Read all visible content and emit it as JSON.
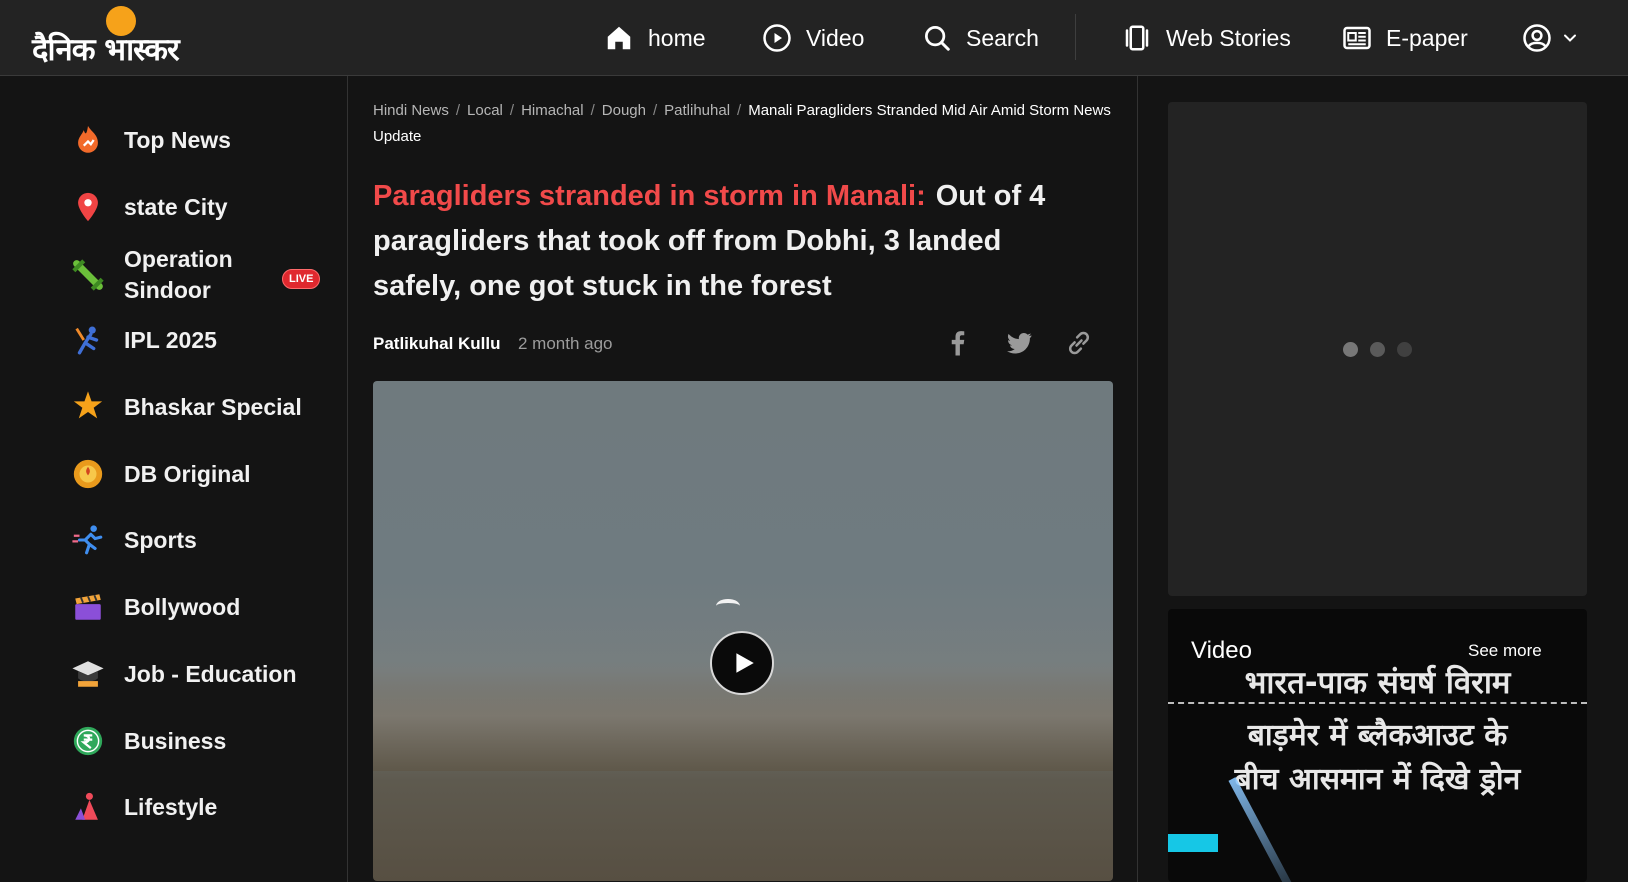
{
  "header": {
    "logo_text": "दैनिक भास्कर",
    "nav": [
      {
        "label": "home",
        "icon": "home-icon"
      },
      {
        "label": "Video",
        "icon": "play-circle-icon"
      },
      {
        "label": "Search",
        "icon": "search-icon"
      },
      {
        "label": "Web Stories",
        "icon": "web-stories-icon"
      },
      {
        "label": "E-paper",
        "icon": "newspaper-icon"
      }
    ],
    "account_icon": "user-circle-icon"
  },
  "sidebar": {
    "items": [
      {
        "label": "Top News",
        "icon": "flame-icon"
      },
      {
        "label": "state City",
        "icon": "location-pin-icon"
      },
      {
        "label": "Operation Sindoor",
        "icon": "missile-icon",
        "badge": "LIVE"
      },
      {
        "label": "IPL 2025",
        "icon": "cricket-icon"
      },
      {
        "label": "Bhaskar Special",
        "icon": "star-icon"
      },
      {
        "label": "DB Original",
        "icon": "db-original-icon"
      },
      {
        "label": "Sports",
        "icon": "runner-icon"
      },
      {
        "label": "Bollywood",
        "icon": "clapperboard-icon"
      },
      {
        "label": "Job - Education",
        "icon": "graduation-cap-icon"
      },
      {
        "label": "Business",
        "icon": "rupee-icon"
      },
      {
        "label": "Lifestyle",
        "icon": "lifestyle-icon"
      }
    ]
  },
  "breadcrumb": {
    "items": [
      "Hindi News",
      "Local",
      "Himachal",
      "Dough",
      "Patlihuhal"
    ],
    "current": "Manali Paragliders Stranded Mid Air Amid Storm News Update"
  },
  "article": {
    "kicker": "Paragliders stranded in storm in Manali:",
    "headline": "Out of 4 paragliders that took off from Dobhi, 3 landed safely, one got stuck in the forest",
    "author": "Patlikuhal Kullu",
    "time": "2 month ago",
    "share": [
      "facebook-icon",
      "twitter-icon",
      "link-icon"
    ]
  },
  "right": {
    "video_card": {
      "title": "Video",
      "see_more": "See more",
      "lines": [
        "भारत-पाक संघर्ष विराम",
        "बाड़मेर में ब्लैकआउट के",
        "बीच आसमान में दिखे ड्रोन"
      ]
    }
  }
}
